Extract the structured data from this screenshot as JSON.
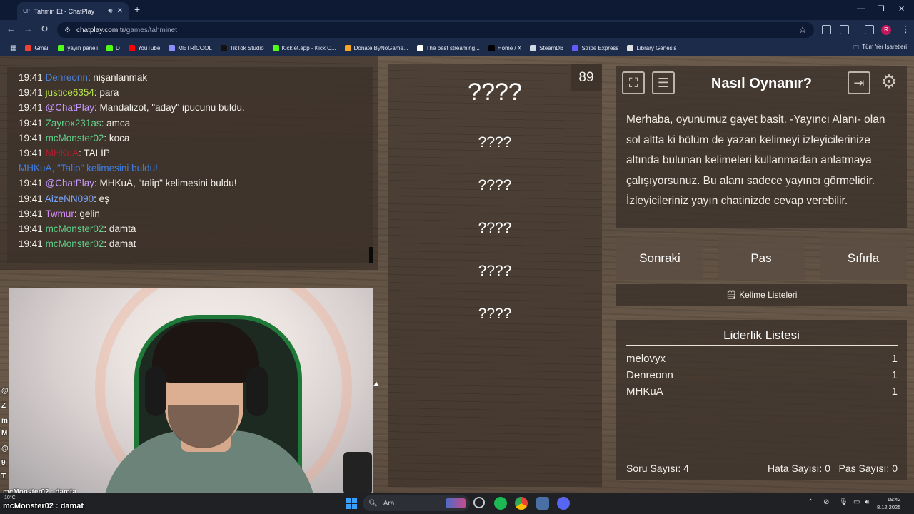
{
  "browser": {
    "tab_favicon": "CP",
    "tab_title": "Tahmin Et - ChatPlay",
    "url_host": "chatplay.com.tr",
    "url_path": "/games/tahminet",
    "bookmarks": [
      {
        "label": "Gmail",
        "color": "#ea4335"
      },
      {
        "label": "yayın paneli",
        "color": "#53fc18"
      },
      {
        "label": "D",
        "color": "#53fc18"
      },
      {
        "label": "YouTube",
        "color": "#ff0000"
      },
      {
        "label": "METRİCOOL",
        "color": "#8a8fff"
      },
      {
        "label": "TikTok Studio",
        "color": "#111111"
      },
      {
        "label": "Kicklet.app - Kick C...",
        "color": "#53fc18"
      },
      {
        "label": "Donate ByNoGame...",
        "color": "#f5a623"
      },
      {
        "label": "The best streaming...",
        "color": "#ffffff"
      },
      {
        "label": "Home / X",
        "color": "#000000"
      },
      {
        "label": "SteamDB",
        "color": "#cfd8e3"
      },
      {
        "label": "Stripe Express",
        "color": "#635bff"
      },
      {
        "label": "Library Genesis",
        "color": "#e0e0e0"
      }
    ],
    "all_bookmarks": "Tüm Yer İşaretleri",
    "profile_initial": "R"
  },
  "chat": {
    "messages": [
      {
        "time": "19:41",
        "user": "Denreonn",
        "user_color": "#4a7fd6",
        "text": ": nişanlanmak"
      },
      {
        "time": "19:41",
        "user": "justice6354",
        "user_color": "#b6e24a",
        "text": ": para"
      },
      {
        "time": "19:41",
        "user": "@ChatPlay",
        "user_color": "#c79bff",
        "text": ": Mandalizot, \"aday\" ipucunu buldu."
      },
      {
        "time": "19:41",
        "user": "Zayrox231as",
        "user_color": "#5fd18a",
        "text": ": amca"
      },
      {
        "time": "19:41",
        "user": "mcMonster02",
        "user_color": "#5fd18a",
        "text": ": koca"
      },
      {
        "time": "19:41",
        "user": "MHKuA",
        "user_color": "#b01e2e",
        "text": ": TALİP"
      },
      {
        "time": "",
        "user": "MHKuA, \"Talip\" kelimesini buldu!.",
        "user_color": "#3d7de0",
        "text": ""
      },
      {
        "time": "19:41",
        "user": "@ChatPlay",
        "user_color": "#c79bff",
        "text": ": MHKuA, \"talip\" kelimesini buldu!"
      },
      {
        "time": "19:41",
        "user": "AizeNN090",
        "user_color": "#7aa6ff",
        "text": ": eş"
      },
      {
        "time": "19:41",
        "user": "Twmur",
        "user_color": "#d88bff",
        "text": ": gelin"
      },
      {
        "time": "19:41",
        "user": "mcMonster02",
        "user_color": "#5fd18a",
        "text": ": damta"
      },
      {
        "time": "19:41",
        "user": "mcMonster02",
        "user_color": "#5fd18a",
        "text": ": damat"
      }
    ]
  },
  "overlay": {
    "frag_lines": [
      "@",
      "Z",
      "m",
      "M",
      "@",
      "9",
      "T"
    ],
    "prev_line": "mcMonster02 : damta",
    "last_line": "mcMonster02 : damat"
  },
  "game": {
    "counter": "89",
    "words": [
      "????",
      "????",
      "????",
      "????",
      "????",
      "????"
    ]
  },
  "howto": {
    "title": "Nasıl Oynanır?",
    "body": "Merhaba, oyunumuz gayet basit. -Yayıncı Alanı- olan sol altta ki bölüm de yazan kelimeyi izleyicilerinize altında bulunan kelimeleri kullanmadan anlatmaya çalışıyorsunuz. Bu alanı sadece yayıncı görmelidir. İzleyicileriniz yayın chatinizde cevap verebilir."
  },
  "buttons": {
    "next": "Sonraki",
    "pass": "Pas",
    "reset": "Sıfırla",
    "word_lists": "Kelime Listeleri"
  },
  "leaderboard": {
    "title": "Liderlik Listesi",
    "rows": [
      {
        "name": "melovyx",
        "score": "1"
      },
      {
        "name": "Denreonn",
        "score": "1"
      },
      {
        "name": "MHKuA",
        "score": "1"
      }
    ],
    "question_count": "Soru Sayısı: 4",
    "error_count": "Hata Sayısı: 0",
    "pass_count": "Pas Sayısı: 0"
  },
  "taskbar": {
    "weather": "10°C",
    "search_placeholder": "Ara",
    "time": "19:42",
    "date": "8.12.2025"
  }
}
